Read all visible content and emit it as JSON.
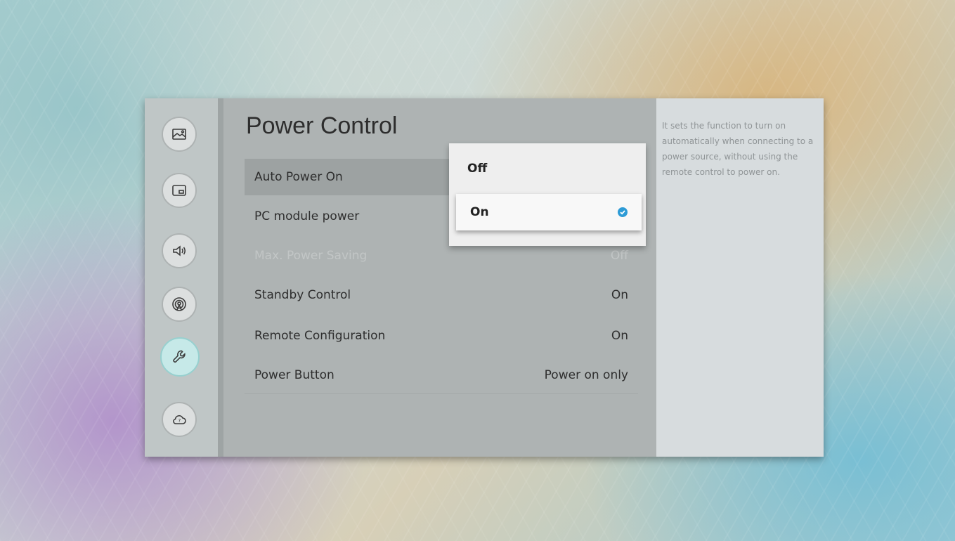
{
  "sidebar": {
    "icons": [
      {
        "name": "picture-icon"
      },
      {
        "name": "picture-in-picture-icon"
      },
      {
        "name": "sound-icon"
      },
      {
        "name": "broadcasting-icon"
      },
      {
        "name": "system-wrench-icon",
        "active": true
      },
      {
        "name": "support-cloud-icon"
      }
    ]
  },
  "page": {
    "title": "Power Control"
  },
  "menu": {
    "items": [
      {
        "label": "Auto Power On",
        "value": "",
        "focused": true
      },
      {
        "label": "PC module power",
        "value": ""
      },
      {
        "label": "Max. Power Saving",
        "value": "Off",
        "disabled": true
      },
      {
        "label": "Standby Control",
        "value": "On"
      },
      {
        "label": "Remote Configuration",
        "value": "On"
      },
      {
        "label": "Power Button",
        "value": "Power on only"
      }
    ]
  },
  "dropdown": {
    "options": [
      {
        "label": "Off"
      },
      {
        "label": "On",
        "selected": true
      }
    ]
  },
  "help": {
    "text": "It sets the function to turn on automatically when connecting to a power source, without using the remote control to power on."
  },
  "colors": {
    "accent_check": "#2d9bd6",
    "active_icon_bg": "#c6e9e8"
  }
}
